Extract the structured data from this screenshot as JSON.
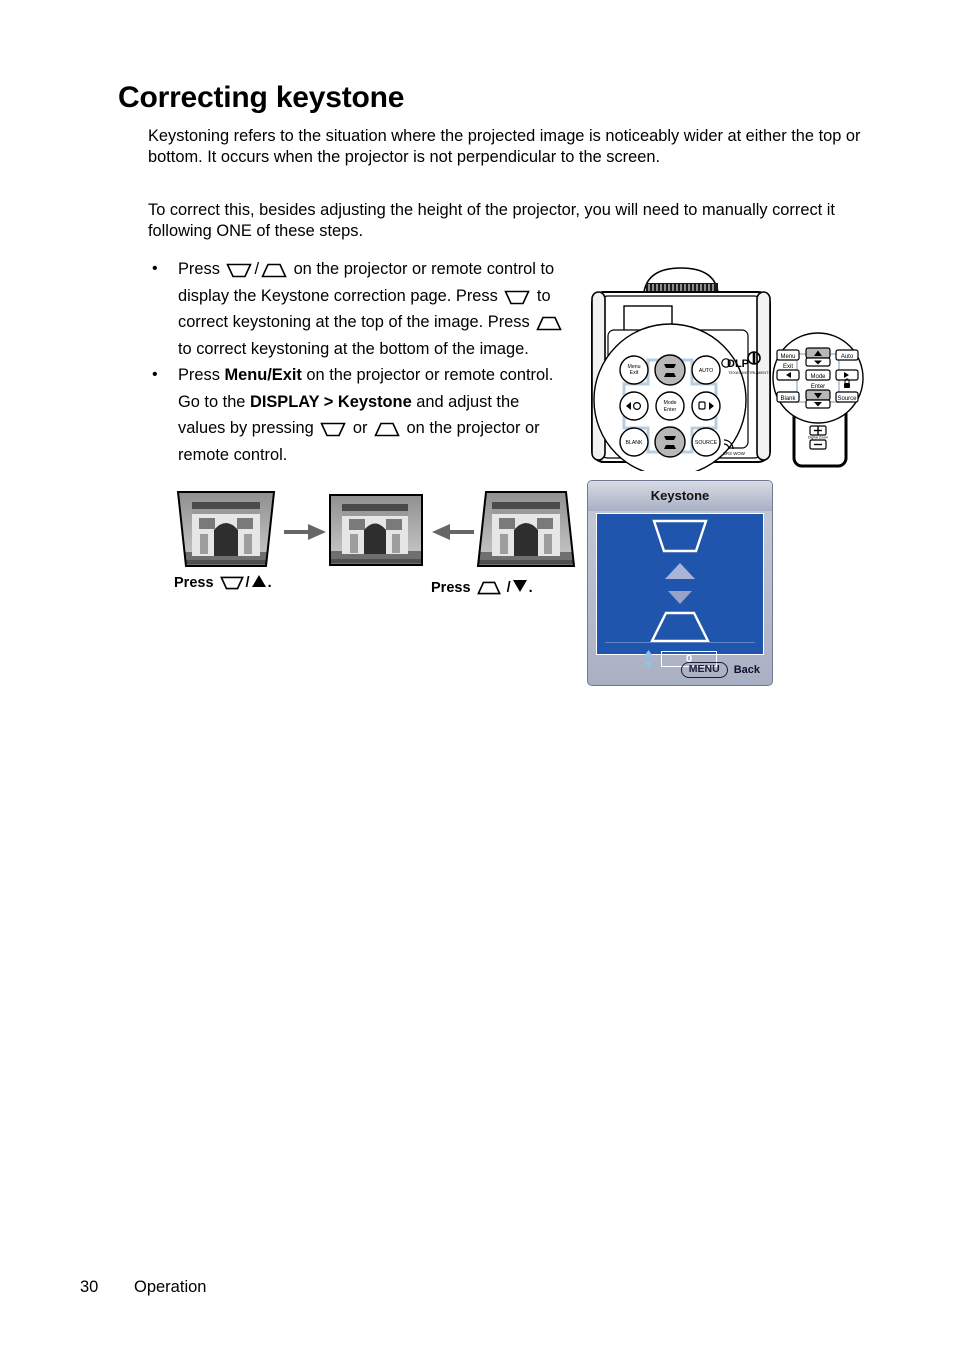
{
  "page": {
    "heading": "Correcting keystone",
    "paragraphs": [
      "Keystoning refers to the situation where the projected image is noticeably wider at either the top or bottom. It occurs when the projector is not perpendicular to the screen.",
      "To correct this, besides adjusting the height of the projector, you will need to manually correct it following ONE of these steps."
    ]
  },
  "bullets": [
    {
      "seg1": "Press ",
      "icon1": "keystone-top-trapezoid-icon",
      "sep1": "/",
      "icon2": "keystone-bottom-trapezoid-icon",
      "seg2": " on the projector or remote control to display the Keystone correction page. Press ",
      "icon3": "keystone-top-trapezoid-icon",
      "seg3": " to correct keystoning at the top of the image. Press ",
      "icon4": "keystone-bottom-trapezoid-icon",
      "seg4": " to correct keystoning at the bottom of the image."
    },
    {
      "seg1": "Press ",
      "bold1": "Menu/Exit",
      "seg2": " on the projector or remote control. Go to the ",
      "bold2": "DISPLAY > Keystone",
      "seg3": " and adjust the values by pressing ",
      "icon1": "keystone-top-trapezoid-icon",
      "seg4": " or ",
      "icon2": "keystone-bottom-trapezoid-icon",
      "seg5": " on the projector or remote control."
    }
  ],
  "thumbnails": {
    "left_caption_prefix": "Press",
    "left_caption_sep": "/",
    "left_caption_suffix": ".",
    "right_caption_prefix": "Press",
    "right_caption_sep": "/",
    "right_caption_suffix": ".",
    "images": [
      {
        "name": "keystoned-top-wide-image",
        "alt": "Arc de Triomphe photo, wider at top"
      },
      {
        "name": "corrected-rectangular-image",
        "alt": "Arc de Triomphe photo, corrected rectangle"
      },
      {
        "name": "keystoned-bottom-wide-image",
        "alt": "Arc de Triomphe photo, wider at bottom"
      }
    ]
  },
  "projector": {
    "buttons": [
      "Menu\nExit",
      "AUTO",
      "Mode\nEnter",
      "BLANK",
      "SOURCE"
    ],
    "logo": "DLP"
  },
  "remote": {
    "buttons": [
      "Menu",
      "Exit",
      "Auto",
      "Mode",
      "Enter",
      "Blank",
      "Source"
    ],
    "zoom_plus": "+",
    "zoom_minus": "−",
    "zoom_label": "Digital Zoom"
  },
  "osd": {
    "title": "Keystone",
    "value": "0",
    "menu_key": "MENU",
    "back_label": "Back",
    "blue": "#2055ae",
    "chrome": "#b5bac9"
  },
  "footer": {
    "page_number": "30",
    "section": "Operation"
  }
}
